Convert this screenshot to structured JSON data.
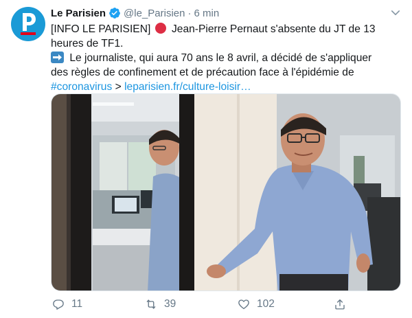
{
  "author": {
    "name": "Le Parisien",
    "handle": "@le_Parisien",
    "separator": "·",
    "time": "6 min",
    "avatar_letter": "P",
    "verified_icon": "verified-badge-icon"
  },
  "tweet": {
    "line1_start": "[INFO LE PARISIEN]",
    "line1_end": "Jean-Pierre Pernaut s'absente du JT de 13",
    "line2": "heures de TF1.",
    "line3": "Le journaliste, qui aura 70 ans le 8 avril, a décidé de s'appliquer",
    "line4": "des règles de confinement et de précaution face à l'épidémie de",
    "hashtag": "#coronavirus",
    "link_arrow": ">",
    "url": "leparisien.fr/culture-loisir…"
  },
  "actions": {
    "reply_count": "11",
    "retweet_count": "39",
    "like_count": "102"
  },
  "colors": {
    "brand_blue": "#1a9ad6",
    "link": "#1b95e0",
    "muted": "#657786",
    "red_circle": "#dd2e44",
    "arrow_emoji_bg": "#3b88c3"
  }
}
